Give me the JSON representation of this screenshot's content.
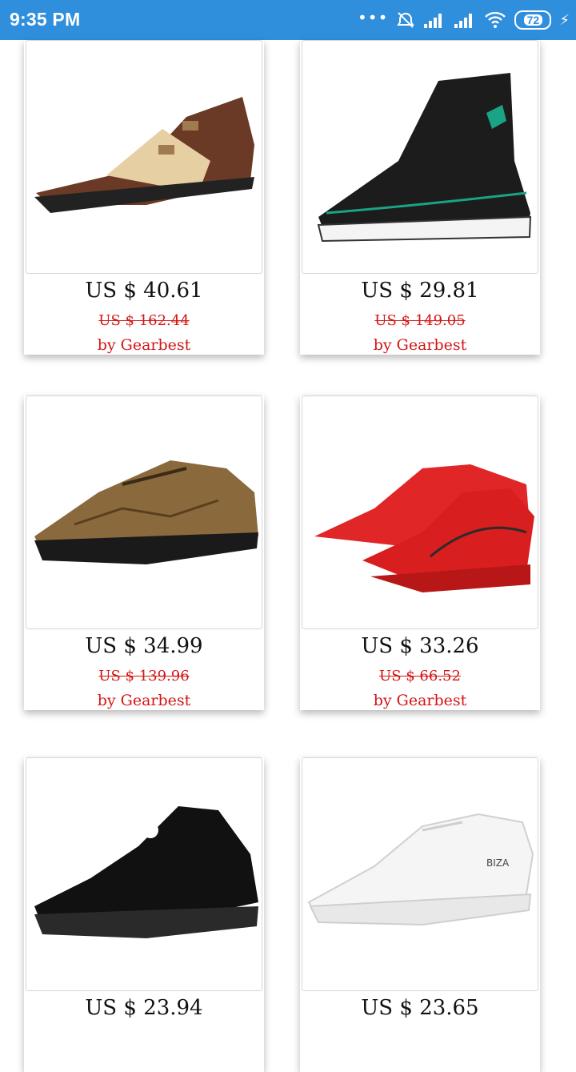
{
  "status_bar": {
    "time": "9:35 PM",
    "battery": "72"
  },
  "products": [
    {
      "price": "US $ 40.61",
      "old_price": "US $ 162.44",
      "seller": "by Gearbest",
      "image": "brown-monk-strap-shoe"
    },
    {
      "price": "US $ 29.81",
      "old_price": "US $ 149.05",
      "seller": "by Gearbest",
      "image": "black-high-top-sneaker"
    },
    {
      "price": "US $ 34.99",
      "old_price": "US $ 139.96",
      "seller": "by Gearbest",
      "image": "brown-leather-loafer"
    },
    {
      "price": "US $ 33.26",
      "old_price": "US $ 66.52",
      "seller": "by Gearbest",
      "image": "red-running-shoes"
    },
    {
      "price": "US $ 23.94",
      "old_price": "",
      "seller": "",
      "image": "black-running-shoe"
    },
    {
      "price": "US $ 23.65",
      "old_price": "",
      "seller": "",
      "image": "white-knit-sneaker"
    }
  ]
}
